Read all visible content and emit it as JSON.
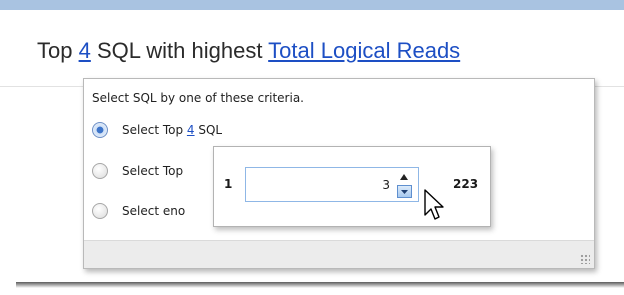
{
  "header": {
    "prefix": "Top ",
    "count_link": "4",
    "middle": " SQL with highest ",
    "metric_link": "Total Logical Reads"
  },
  "popup": {
    "prompt": "Select SQL by one of these criteria.",
    "options": [
      {
        "prefix": "Select Top ",
        "link": "4",
        "suffix": " SQL",
        "checked": true
      },
      {
        "label": "Select Top",
        "checked": false
      },
      {
        "label": "Select eno",
        "checked": false
      }
    ]
  },
  "spinner": {
    "min": "1",
    "max": "223",
    "value": "3"
  },
  "colors": {
    "link": "#1d4fc4",
    "top_band": "#a9c3e1",
    "radio_selected": "#3d74c9",
    "spinner_border": "#8fb7e6"
  },
  "icons": [
    "radio-selected-icon",
    "radio-unselected-icon",
    "spin-up-icon",
    "spin-down-icon",
    "resize-grip-icon",
    "mouse-cursor-icon"
  ]
}
